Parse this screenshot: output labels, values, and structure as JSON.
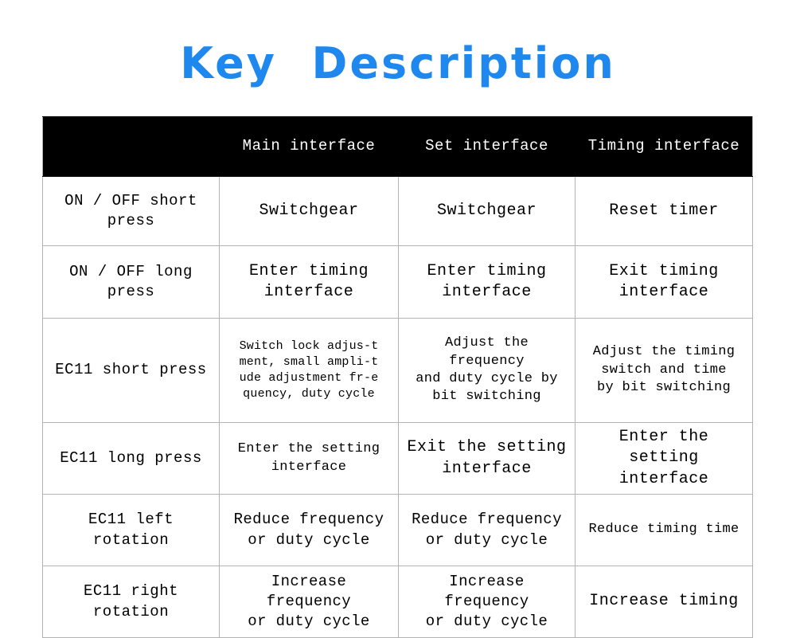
{
  "title": "Key  Description",
  "theme": {
    "title_color": "#1e88ee",
    "header_bg": "#000000",
    "header_text": "#ffffff",
    "border_color": "#b3b3b3",
    "cell_bg": "#ffffff",
    "cell_text": "#000000"
  },
  "table": {
    "columns": [
      {
        "label": ""
      },
      {
        "label": "Main interface"
      },
      {
        "label": "Set interface"
      },
      {
        "label": "Timing interface"
      }
    ],
    "rows": [
      {
        "label": "ON / OFF short\npress",
        "main": "Switchgear",
        "set": "Switchgear",
        "timing": "Reset timer"
      },
      {
        "label": "ON / OFF long\npress",
        "main": "Enter timing\ninterface",
        "set": "Enter timing\ninterface",
        "timing": "Exit timing\ninterface"
      },
      {
        "label": "EC11 short press",
        "main": "Switch lock adjus-t\nment, small ampli-t\nude adjustment fr-e\nquency, duty cycle",
        "set": "Adjust the frequency\nand duty cycle by\nbit switching",
        "timing": "Adjust the timing\nswitch and time\nby bit switching"
      },
      {
        "label": "EC11 long press",
        "main": "Enter the setting\ninterface",
        "set": "Exit the setting\ninterface",
        "timing": "Enter the setting\ninterface"
      },
      {
        "label": "EC11 left\nrotation",
        "main": "Reduce frequency\nor duty cycle",
        "set": "Reduce frequency\nor duty cycle",
        "timing": "Reduce timing time"
      },
      {
        "label": "EC11 right\nrotation",
        "main": "Increase frequency\nor duty cycle",
        "set": "Increase frequency\nor duty cycle",
        "timing": "Increase timing"
      }
    ]
  }
}
